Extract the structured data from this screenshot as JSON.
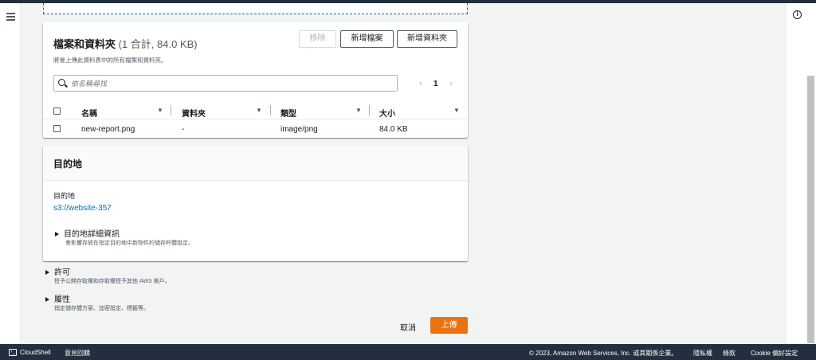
{
  "files": {
    "title": "檔案和資料夾",
    "count": "(1 合計, 84.0 KB)",
    "description": "將會上傳此資料表中的所有檔案和資料夾。",
    "remove_label": "移除",
    "add_files_label": "新增檔案",
    "add_folder_label": "新增資料夾",
    "search_placeholder": "依名稱尋找",
    "page_prev": "‹",
    "page_number": "1",
    "page_next": "›",
    "columns": [
      "名稱",
      "資料夾",
      "類型",
      "大小"
    ],
    "rows": [
      {
        "name": "new-report.png",
        "folder": "-",
        "type": "image/png",
        "size": "84.0 KB"
      }
    ]
  },
  "destination": {
    "title": "目的地",
    "label": "目的地",
    "link": "s3://website-357",
    "details_title": "目的地詳細資訊",
    "details_desc": "會影響存放在指定目的地中新物件的儲存貯體設定。"
  },
  "permissions": {
    "title": "許可",
    "desc": "授予公開存取權和存取權授予其他 AWS 帳戶。"
  },
  "properties": {
    "title": "屬性",
    "desc": "指定儲存體方案、加密設定、標籤等。"
  },
  "actions": {
    "cancel_label": "取消",
    "upload_label": "上傳"
  },
  "footer": {
    "cloudshell_icon": "›_",
    "cloudshell": "CloudShell",
    "feedback": "意見回饋",
    "copyright": "© 2023, Amazon Web Services, Inc. 或其關係企業。",
    "privacy": "隱私權",
    "terms": "條款",
    "cookies": "Cookie 偏好設定"
  },
  "icons": {
    "menu": "hamburger-menu-icon",
    "info": "info-icon",
    "search": "search-icon",
    "sort": "sort-down-icon",
    "expand": "caret-right-icon",
    "cloudshell": "terminal-icon"
  },
  "info_glyph": "i",
  "colors": {
    "link": "#0073bb",
    "primary_button": "#ec7211",
    "nav_dark": "#232f3e",
    "background": "#f2f3f3"
  }
}
